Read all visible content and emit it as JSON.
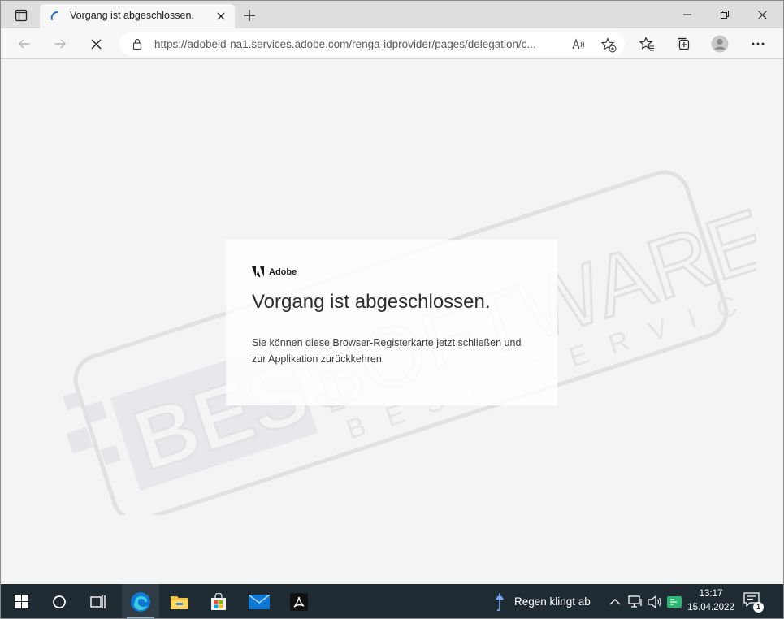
{
  "browser": {
    "tab": {
      "title": "Vorgang ist abgeschlossen."
    },
    "address_bar": {
      "url": "https://adobeid-na1.services.adobe.com/renga-idprovider/pages/delegation/c..."
    }
  },
  "page": {
    "brand": "Adobe",
    "heading": "Vorgang ist abgeschlossen.",
    "message": "Sie können diese Browser-Registerkarte jetzt schließen und zur Applikation zurückkehren.",
    "watermark": {
      "main": "BEST SOFTWARE",
      "sub": "BEST SERVICE"
    }
  },
  "taskbar": {
    "weather_text": "Regen klingt ab",
    "time": "13:17",
    "date": "15.04.2022",
    "notification_count": "1"
  },
  "colors": {
    "taskbar_bg": "#1f2b33",
    "tab_bar_bg": "#dedede",
    "toolbar_bg": "#f7f7f7",
    "edge_blue": "#0f78d4",
    "adobe_red": "#eb1000"
  }
}
